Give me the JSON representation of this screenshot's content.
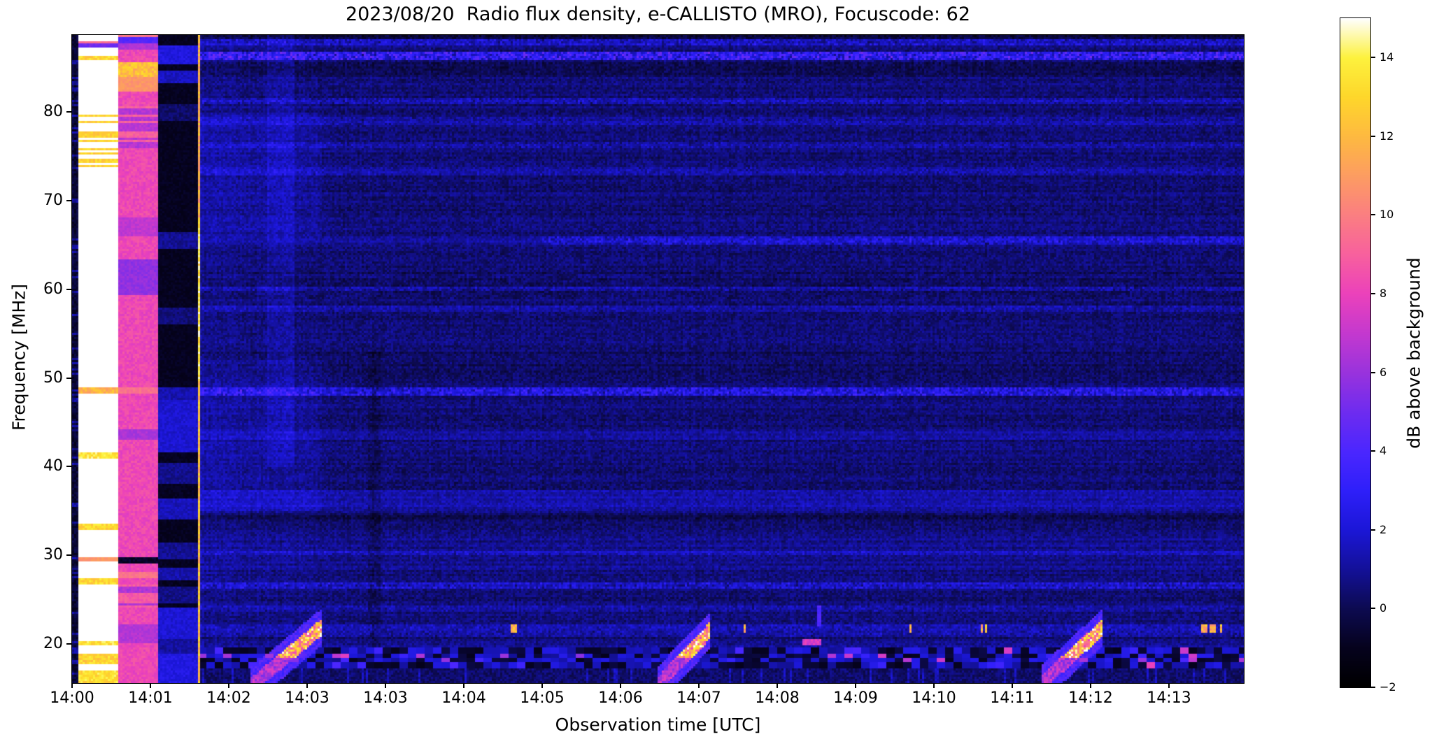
{
  "chart_data": {
    "type": "heatmap",
    "subtype": "radio-spectrogram",
    "title": "2023/08/20  Radio flux density, e-CALLISTO (MRO), Focuscode: 62",
    "xlabel": "Observation time [UTC]",
    "ylabel": "Frequency [MHz]",
    "colorbar_label": "dB above background",
    "x_ticks": [
      "14:00",
      "14:01",
      "14:02",
      "14:03",
      "14:03",
      "14:04",
      "14:05",
      "14:06",
      "14:07",
      "14:08",
      "14:09",
      "14:10",
      "14:11",
      "14:12",
      "14:13"
    ],
    "y_ticks": {
      "values": [
        80,
        70,
        60,
        50,
        40,
        30,
        20
      ],
      "labels": [
        "80",
        "70",
        "60",
        "50",
        "40",
        "30",
        "20"
      ]
    },
    "colorbar_ticks": {
      "values": [
        14,
        12,
        10,
        8,
        6,
        4,
        2,
        0,
        -2
      ],
      "labels": [
        "14",
        "12",
        "10",
        "8",
        "6",
        "4",
        "2",
        "0",
        "−2"
      ]
    },
    "freq_range_mhz": [
      15.58,
      88.7
    ],
    "value_range_db": [
      -2,
      15
    ],
    "grid": false,
    "colormap": {
      "name": "gnuplot2-like",
      "stops": [
        [
          -2,
          "#000000"
        ],
        [
          -1,
          "#06031e"
        ],
        [
          0,
          "#0d0b52"
        ],
        [
          1,
          "#14119a"
        ],
        [
          2,
          "#1c17d8"
        ],
        [
          3,
          "#2f20fa"
        ],
        [
          4,
          "#4c27ff"
        ],
        [
          5,
          "#6f2cf0"
        ],
        [
          6,
          "#9a33dd"
        ],
        [
          7,
          "#c539cf"
        ],
        [
          8,
          "#ec42bb"
        ],
        [
          9,
          "#f8619e"
        ],
        [
          10,
          "#fb7f82"
        ],
        [
          11,
          "#fd9d62"
        ],
        [
          12,
          "#feba41"
        ],
        [
          13,
          "#fed72b"
        ],
        [
          14,
          "#fdf23e"
        ],
        [
          15,
          "#ffffff"
        ]
      ]
    },
    "features": {
      "minutes_span": 14.95,
      "calibration_columns": {
        "dark_gap": {
          "t0": 0.0,
          "t1": 0.08,
          "base_db": -1.1
        },
        "white_saturated": {
          "t0": 0.08,
          "t1": 0.58,
          "base_db": 15,
          "bands": [
            [
              88.6,
              89.0,
              11,
              "n"
            ],
            [
              87.7,
              88.1,
              9.5,
              "n"
            ],
            [
              87.2,
              87.7,
              5,
              "n"
            ],
            [
              85.8,
              86.4,
              13,
              "s"
            ],
            [
              73.2,
              80.5,
              13,
              "alt"
            ],
            [
              48.2,
              48.9,
              11.8,
              "s"
            ],
            [
              40.9,
              41.6,
              13.5,
              "s"
            ],
            [
              32.9,
              33.6,
              13,
              "s"
            ],
            [
              29.2,
              29.8,
              10.8,
              "n"
            ],
            [
              26.7,
              27.3,
              13,
              "s"
            ],
            [
              19.8,
              20.4,
              13.4,
              "s"
            ],
            [
              17.6,
              18.9,
              13,
              "s"
            ],
            [
              15.6,
              17.0,
              13.3,
              "s"
            ]
          ]
        },
        "pink_column": {
          "t0": 0.58,
          "t1": 1.09,
          "base_db": 8.2,
          "bands": [
            [
              88.5,
              89.0,
              9.8,
              "n"
            ],
            [
              87.8,
              88.5,
              4.2,
              "n"
            ],
            [
              87.0,
              87.8,
              6.5,
              "n"
            ],
            [
              84.0,
              85.6,
              12.2,
              "s"
            ],
            [
              82.3,
              84.0,
              10.8,
              "n"
            ],
            [
              76.0,
              80.6,
              9.0,
              "alt2"
            ],
            [
              66.0,
              68.2,
              6.9,
              "n"
            ],
            [
              59.4,
              63.4,
              5.8,
              "n"
            ],
            [
              48.2,
              48.9,
              9.6,
              "n"
            ],
            [
              43.0,
              44.1,
              6.4,
              "n"
            ],
            [
              29.15,
              29.75,
              -0.8,
              "n"
            ],
            [
              27.4,
              28.2,
              9.7,
              "n"
            ],
            [
              24.0,
              26.6,
              8.8,
              "alt2"
            ],
            [
              20.0,
              22.2,
              6.6,
              "n"
            ]
          ]
        },
        "black_column": {
          "t0": 1.09,
          "t1": 1.607,
          "base_db": -1.25,
          "bands": [
            [
              85.3,
              87.5,
              2.2
            ],
            [
              83.2,
              84.6,
              1.6
            ],
            [
              79.0,
              81.0,
              0.3
            ],
            [
              64.6,
              66.4,
              0.9
            ],
            [
              56.1,
              57.9,
              0.5
            ],
            [
              47.6,
              49.0,
              1.3
            ],
            [
              41.6,
              47.5,
              1.9
            ],
            [
              38.0,
              40.4,
              0.8
            ],
            [
              34.0,
              36.5,
              1.5
            ],
            [
              29.5,
              31.5,
              0.9
            ],
            [
              27.2,
              28.6,
              1.3
            ],
            [
              24.5,
              26.5,
              0.7
            ],
            [
              20.5,
              24.2,
              2.0
            ],
            [
              18.8,
              20.5,
              1.1
            ],
            [
              15.6,
              18.8,
              2.3
            ]
          ]
        },
        "bright_line": {
          "t0": 1.607,
          "t1": 1.634,
          "base_db": 12
        }
      },
      "background_noise": {
        "base_db": 0.42,
        "row_jitter": 0.55,
        "col_jitter": 0.3,
        "cell_jitter": 1.15
      },
      "horizontal_bands": [
        [
          88.2,
          88.7,
          -0.9,
          "f"
        ],
        [
          87.6,
          88.3,
          1.1,
          "s"
        ],
        [
          85.9,
          86.7,
          2.3,
          "s"
        ],
        [
          84.0,
          85.7,
          -0.45,
          "f"
        ],
        [
          80.9,
          81.7,
          0.9,
          "s"
        ],
        [
          78.6,
          79.4,
          0.6,
          "s"
        ],
        [
          75.9,
          76.7,
          0.7,
          "s"
        ],
        [
          72.9,
          73.7,
          0.6,
          "s"
        ],
        [
          65.1,
          66.1,
          1.4,
          "r"
        ],
        [
          59.0,
          62.0,
          -0.35,
          "p"
        ],
        [
          59.8,
          60.4,
          0.8,
          "s"
        ],
        [
          57.4,
          58.1,
          0.6,
          "s"
        ],
        [
          48.1,
          49.0,
          1.6,
          "s"
        ],
        [
          49.5,
          53.0,
          -0.25,
          "f"
        ],
        [
          43.0,
          44.2,
          0.5,
          "f"
        ],
        [
          34.9,
          37.3,
          0.8,
          "f"
        ],
        [
          33.8,
          34.8,
          -0.45,
          "f"
        ],
        [
          29.9,
          30.6,
          0.7,
          "s"
        ],
        [
          28.3,
          32.0,
          0.35,
          "f"
        ],
        [
          26.3,
          26.9,
          1.2,
          "s"
        ],
        [
          23.6,
          24.4,
          0.6,
          "s"
        ],
        [
          20.9,
          22.3,
          0.7,
          "s"
        ],
        [
          19.6,
          20.6,
          0.4,
          "f"
        ],
        [
          15.6,
          17.3,
          0.5,
          "s"
        ]
      ],
      "left_enhancement": {
        "t_end": 3.4,
        "boost_db": 0.55,
        "hf_patch": [
          66,
          80,
          0.45
        ],
        "mf_patch": [
          35,
          52,
          0.4
        ]
      },
      "vertical_stripe_bright": {
        "t0": 2.5,
        "t1": 2.85,
        "f_min": 40,
        "boost_db": 0.5
      },
      "vertical_stripe_dark": {
        "t0": 3.77,
        "t1": 3.95,
        "f_max": 53,
        "boost_db": -0.5
      },
      "checkerboard_band": {
        "f0": 17.35,
        "f1": 19.55,
        "dark_db": -1.1,
        "bright_db": 1.8,
        "magenta_db": 6.5
      },
      "type3_bursts": [
        {
          "t0": 2.28,
          "t1": 3.2,
          "f0": 15.2,
          "f1": 22.0
        },
        {
          "t0": 7.46,
          "t1": 8.13,
          "f0": 15.2,
          "f1": 21.4
        },
        {
          "t0": 12.37,
          "t1": 13.15,
          "f0": 15.5,
          "f1": 21.8
        }
      ],
      "rfi_dots": {
        "freq_mhz": 21.7,
        "minutes": [
          5.65,
          8.64,
          10.66,
          11.65,
          14.48,
          14.62
        ],
        "db": 11.5
      },
      "magenta_blob": {
        "t0": 9.33,
        "t1": 9.56,
        "f0": 19.9,
        "f1": 20.65,
        "db": 7.0
      },
      "blue_vline": {
        "t": 9.54,
        "f0": 21.9,
        "f1": 24.4,
        "db": 4.0
      }
    }
  }
}
